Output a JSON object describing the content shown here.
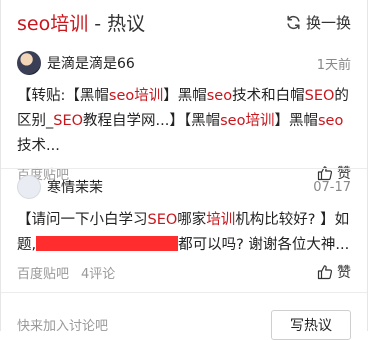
{
  "header": {
    "title_keyword": "seo培训",
    "title_rest": " - 热议",
    "refresh_label": "换一换"
  },
  "posts": [
    {
      "author": "是滴是滴是66",
      "time": "1天前",
      "segments": [
        {
          "t": "【转贴:【黑帽",
          "h": false
        },
        {
          "t": "seo培训",
          "h": true
        },
        {
          "t": "】黑帽",
          "h": false
        },
        {
          "t": "seo",
          "h": true
        },
        {
          "t": "技术和白帽",
          "h": false
        },
        {
          "t": "SEO",
          "h": true
        },
        {
          "t": "的区别_",
          "h": false
        },
        {
          "t": "SEO",
          "h": true
        },
        {
          "t": "教程自学网...】【黑帽",
          "h": false
        },
        {
          "t": "seo培训",
          "h": true
        },
        {
          "t": "】黑帽",
          "h": false
        },
        {
          "t": "seo",
          "h": true
        },
        {
          "t": "技术...",
          "h": false
        }
      ],
      "source": "百度贴吧",
      "comments": "",
      "like_label": "赞"
    },
    {
      "author": "寒情茉茉",
      "time": "07-17",
      "segments_before": [
        {
          "t": "【请问一下小白学习",
          "h": false
        },
        {
          "t": "SEO",
          "h": true
        },
        {
          "t": "哪家",
          "h": false
        },
        {
          "t": "培训",
          "h": true
        },
        {
          "t": "机构比较好? 】如题,",
          "h": false
        }
      ],
      "segments_after": [
        {
          "t": "都可以吗? 谢谢各位大神...",
          "h": false
        }
      ],
      "source": "百度贴吧",
      "comments": "4评论",
      "like_label": "赞"
    }
  ],
  "footer": {
    "hint": "快来加入讨论吧",
    "write_label": "写热议"
  },
  "colors": {
    "accent": "#c8161d",
    "redaction": "#ff2d2d",
    "muted": "#999999"
  }
}
